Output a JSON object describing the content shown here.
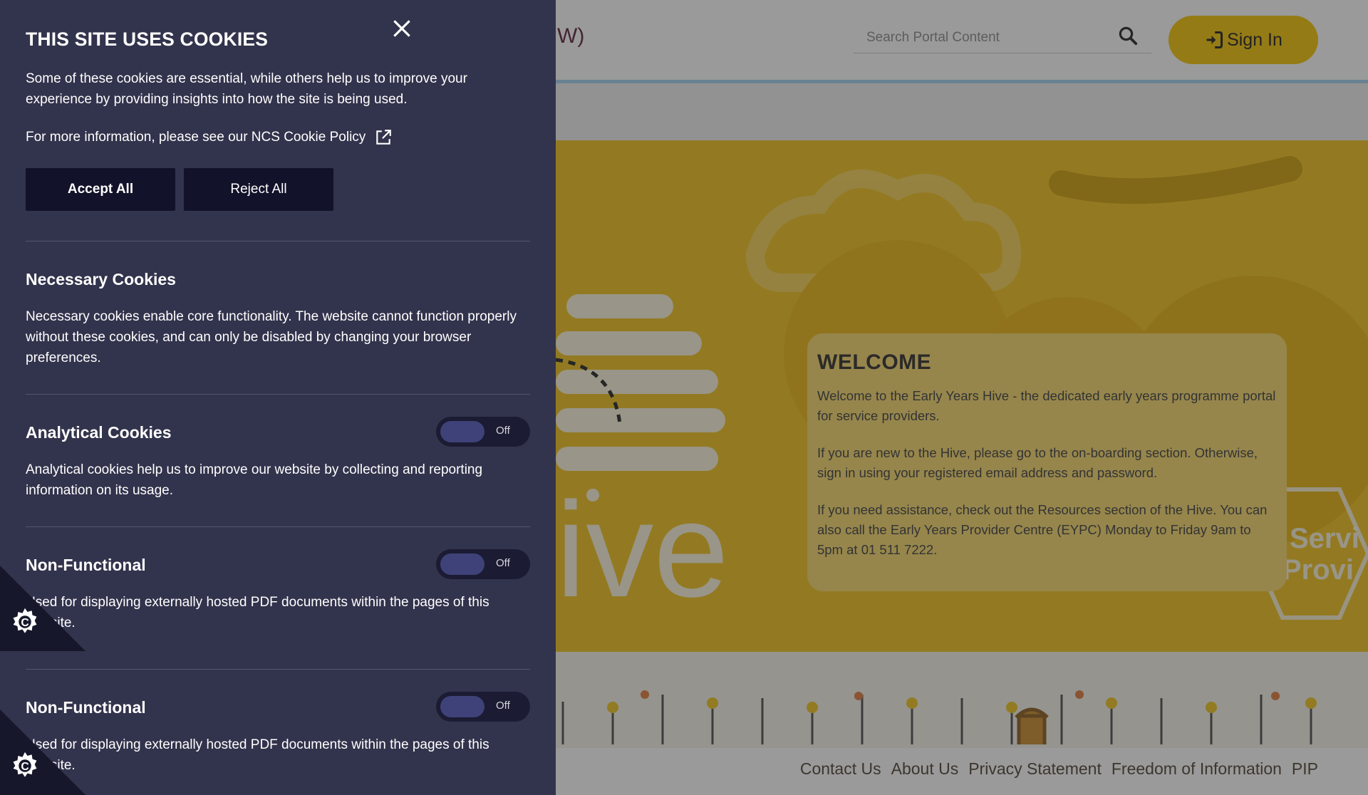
{
  "header": {
    "title_fragment": "W)",
    "search_placeholder": "Search Portal Content",
    "signin_label": "Sign In"
  },
  "hero": {
    "brand_fragment": "ive",
    "badge_text_line1": "Servi",
    "badge_text_line2": "Provi"
  },
  "welcome": {
    "title": "WELCOME",
    "p1": "Welcome to the Early Years Hive - the dedicated early years programme portal for service providers.",
    "p2": "If you are new to the Hive, please go to the on-boarding section. Otherwise, sign in using your registered email address and password.",
    "p3": "If you need assistance, check out the Resources section of the Hive. You can also call the Early Years Provider Centre (EYPC) Monday to Friday 9am to 5pm at 01 511 7222."
  },
  "footer": {
    "links": [
      "Contact Us",
      "About Us",
      "Privacy Statement",
      "Freedom of Information",
      "PIP"
    ]
  },
  "cookie_panel": {
    "title": "THIS SITE USES COOKIES",
    "intro": "Some of these cookies are essential, while others help us to improve your experience by providing insights into how the site is being used.",
    "more_info": "For more information, please see our NCS Cookie Policy",
    "accept_label": "Accept All",
    "reject_label": "Reject All",
    "sections": [
      {
        "heading": "Necessary Cookies",
        "text": "Necessary cookies enable core functionality. The website cannot function properly without these cookies, and can only be disabled by changing your browser preferences."
      },
      {
        "heading": "Analytical Cookies",
        "text": "Analytical cookies help us to improve our website by collecting and reporting information on its usage.",
        "toggle": "Off"
      },
      {
        "heading": "Non-Functional",
        "text": "Used for displaying externally hosted PDF documents within the pages of this website.",
        "toggle": "Off"
      },
      {
        "heading": "Non-Functional",
        "text": "Used for displaying externally hosted PDF documents within the pages of this website.",
        "toggle": "Off"
      }
    ]
  },
  "icons": {
    "close": "close-icon",
    "external": "external-link-icon",
    "search": "search-icon",
    "signin": "sign-in-icon",
    "cookie_settings": "cookie-gear-icon"
  },
  "colors": {
    "panel_bg": "#32334c",
    "button_bg": "#12132a",
    "brand_yellow": "#f4c400"
  }
}
